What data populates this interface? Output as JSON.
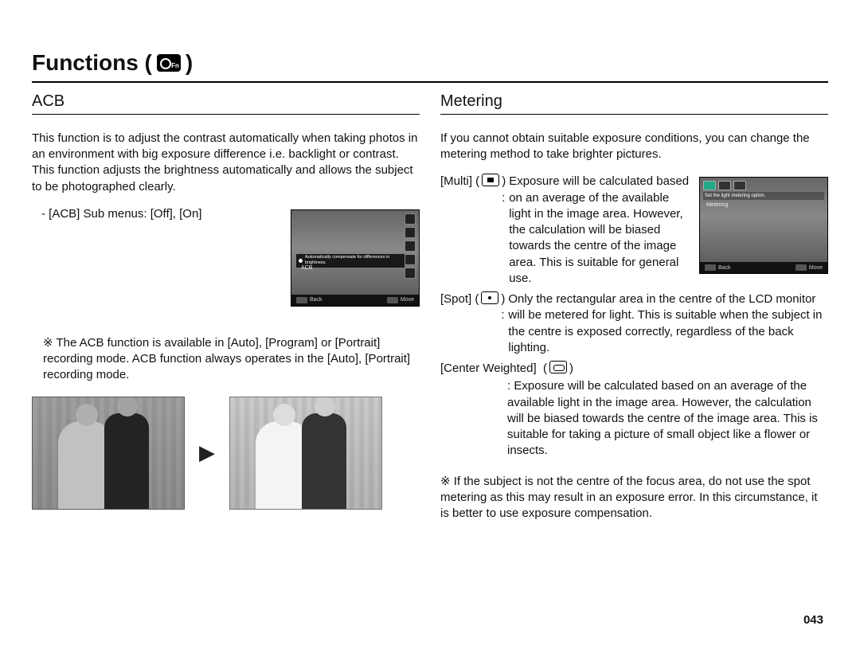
{
  "page_title_prefix": "Functions (",
  "page_title_suffix": " )",
  "page_number": "043",
  "left": {
    "heading": "ACB",
    "intro": "This function is to adjust the contrast automatically when taking photos in an environment with big exposure difference i.e. backlight or contrast. This function adjusts the brightness automatically and allows the subject to be photographed clearly.",
    "submenu_line": "- [ACB] Sub menus: [Off], [On]",
    "lcd": {
      "tip": "Automatically compensate for differences in brightness.",
      "mode_label": "ACB",
      "back": "Back",
      "move": "Move"
    },
    "note": "※ The ACB function is available in [Auto], [Program] or [Portrait] recording mode. ACB function always operates in the [Auto], [Portrait] recording mode.",
    "arrow": "▶"
  },
  "right": {
    "heading": "Metering",
    "intro": "If you cannot obtain suitable exposure conditions, you can change the metering method to take brighter pictures.",
    "lcd": {
      "help": "Set the light metering option.",
      "mode_label": "Metering",
      "back": "Back",
      "move": "Move"
    },
    "options": [
      {
        "label": "[Multi]",
        "desc": "Exposure will be calculated based on an average of the available light in the image area. However, the calculation will be biased towards the centre of the image area. This is suitable for general use."
      },
      {
        "label": "[Spot]",
        "desc": "Only the rectangular area in the centre of the LCD monitor will be metered for light. This is suitable when the subject in the centre is exposed correctly, regardless of the back lighting."
      },
      {
        "label": "[Center Weighted]",
        "desc": "Exposure will be calculated based on an average of the available light in the image area. However, the calculation will be biased towards the centre of the image area. This is suitable for taking a picture of small object like a flower or insects."
      }
    ],
    "note": "※ If the subject is not the centre of the focus area, do not use the spot metering as this may result in an exposure error. In this circumstance, it is better to use exposure compensation."
  }
}
